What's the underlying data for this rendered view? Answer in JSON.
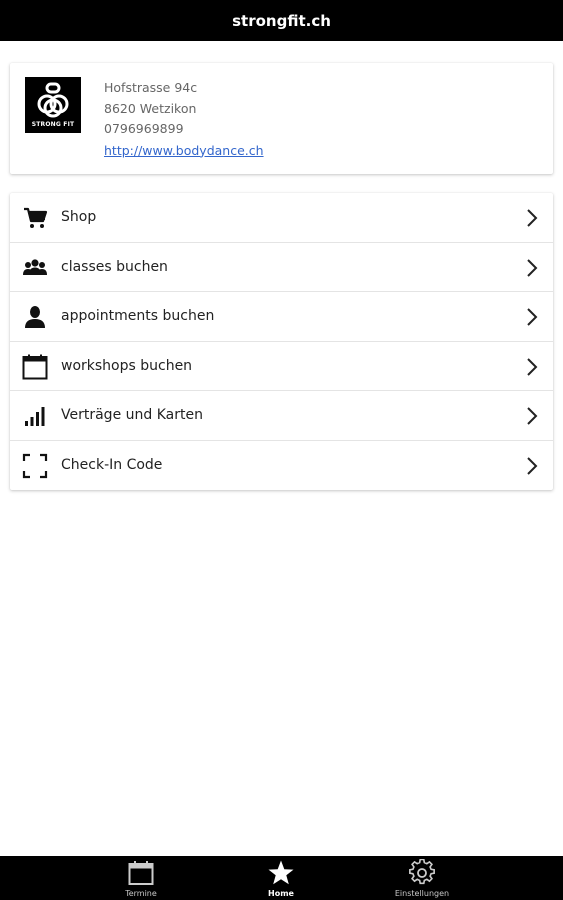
{
  "app": {
    "title": "strongfit.ch"
  },
  "info": {
    "logo_text": "STRONG FIT",
    "address": "Hofstrasse 94c",
    "city": "8620 Wetzikon",
    "phone": "0796969899",
    "website": "http://www.bodydance.ch",
    "link_color": "#3366cc"
  },
  "menu": {
    "items": [
      {
        "label": "Shop",
        "icon": "cart-icon"
      },
      {
        "label": "classes buchen",
        "icon": "group-icon"
      },
      {
        "label": "appointments buchen",
        "icon": "person-icon"
      },
      {
        "label": "workshops buchen",
        "icon": "calendar-icon"
      },
      {
        "label": "Verträge und Karten",
        "icon": "signal-bars-icon"
      },
      {
        "label": "Check-In Code",
        "icon": "scan-frame-icon"
      }
    ]
  },
  "tabbar": {
    "tabs": [
      {
        "label": "Termine",
        "icon": "calendar-icon",
        "active": false
      },
      {
        "label": "Home",
        "icon": "star-icon",
        "active": true
      },
      {
        "label": "Einstellungen",
        "icon": "gear-icon",
        "active": false
      }
    ]
  }
}
